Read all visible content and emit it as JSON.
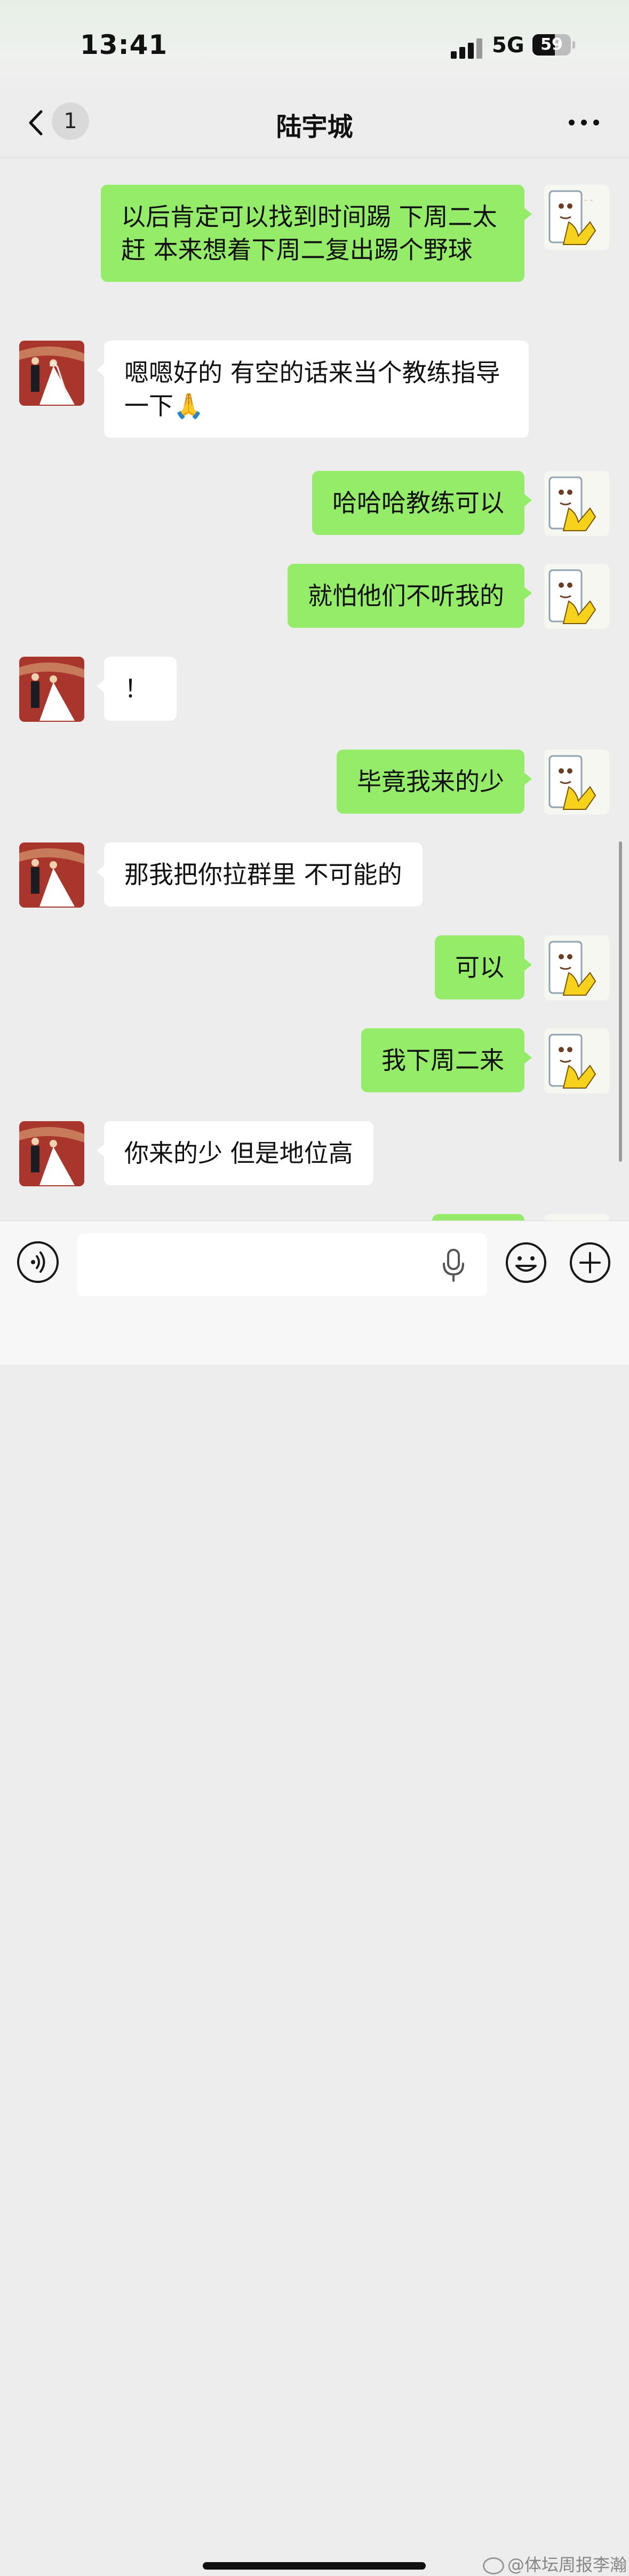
{
  "status_bar": {
    "time": "13:41",
    "network": "5G",
    "battery": "59"
  },
  "nav": {
    "badge": "1",
    "title": "陆宇城"
  },
  "messages": [
    {
      "from": "me",
      "text": "以后肯定可以找到时间踢 下周二太赶 本来想着下周二复出踢个野球"
    },
    {
      "from": "friend",
      "text": "嗯嗯好的 有空的话来当个教练指导一下🙏"
    },
    {
      "from": "me",
      "text": "哈哈哈教练可以"
    },
    {
      "from": "me",
      "text": "就怕他们不听我的"
    },
    {
      "from": "friend",
      "text": "！"
    },
    {
      "from": "me",
      "text": "毕竟我来的少"
    },
    {
      "from": "friend",
      "text": "那我把你拉群里 不可能的"
    },
    {
      "from": "me",
      "text": "可以"
    },
    {
      "from": "me",
      "text": "我下周二来"
    },
    {
      "from": "friend",
      "text": "你来的少 但是地位高"
    }
  ],
  "input": {
    "value": "",
    "placeholder": ""
  },
  "watermark": "@体坛周报李瀚",
  "icons": {
    "back": "chevron-left-icon",
    "more": "more-dots-icon",
    "voice": "voice-icon",
    "mic": "microphone-icon",
    "emoji": "emoji-icon",
    "plus": "plus-icon"
  },
  "colors": {
    "my_bubble": "#95ec69",
    "friend_bubble": "#ffffff",
    "background": "#ededed"
  }
}
